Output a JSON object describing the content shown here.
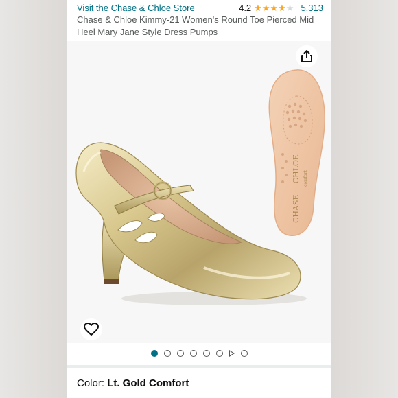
{
  "header": {
    "store_link": "Visit the Chase & Chloe Store",
    "rating_value": "4.2",
    "stars": {
      "full": 4,
      "half": 0,
      "empty": 1
    },
    "rating_count": "5,313"
  },
  "product": {
    "title": "Chase & Chloe Kimmy-21 Women's Round Toe Pierced Mid Heel Mary Jane Style Dress Pumps",
    "insole_brand_text": "CHASE + CHLOE",
    "insole_sub_text": "comfort"
  },
  "gallery": {
    "total_dots": 7,
    "active_index": 0,
    "has_video": true,
    "icons": {
      "share": "share-icon",
      "wishlist": "heart-icon"
    }
  },
  "variation": {
    "label": "Color:",
    "value": "Lt. Gold Comfort"
  },
  "colors": {
    "link": "#007185",
    "star": "#ffa41c",
    "text": "#0f1111",
    "secondary_text": "#565959"
  }
}
